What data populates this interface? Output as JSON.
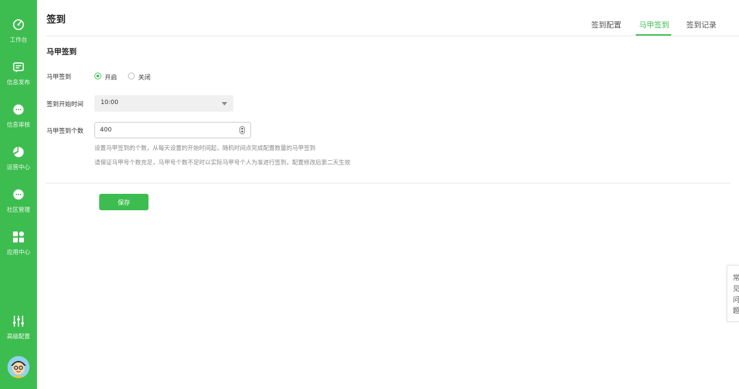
{
  "sidebar": {
    "items": [
      {
        "label": "工作台",
        "icon": "dashboard-icon"
      },
      {
        "label": "信息发布",
        "icon": "publish-icon"
      },
      {
        "label": "信息审核",
        "icon": "review-chat-icon"
      },
      {
        "label": "运营中心",
        "icon": "operations-icon"
      },
      {
        "label": "社区管理",
        "icon": "community-chat-icon"
      },
      {
        "label": "应用中心",
        "icon": "apps-grid-icon"
      }
    ],
    "bottom_item": {
      "label": "高级配置",
      "icon": "sliders-icon"
    }
  },
  "header": {
    "title": "签到",
    "tabs": [
      {
        "label": "签到配置",
        "active": false
      },
      {
        "label": "马甲签到",
        "active": true
      },
      {
        "label": "签到记录",
        "active": false
      }
    ]
  },
  "section": {
    "title": "马甲签到"
  },
  "form": {
    "toggle_label": "马甲签到",
    "toggle_options": [
      {
        "label": "开启",
        "checked": true
      },
      {
        "label": "关闭",
        "checked": false
      }
    ],
    "start_time_label": "签到开始时间",
    "start_time_value": "10:00",
    "count_label": "马甲签到个数",
    "count_value": "400",
    "hint_1": "设置马甲签到的个数，从每天设置的开始时间起，随机时间点完成配置数量的马甲签到",
    "hint_2": "请保证马甲号个数充足，马甲号个数不足时以实际马甲号个人为准进行签到，配置修改后第二天生效"
  },
  "save_label": "保存",
  "faq": {
    "chars": [
      "常",
      "见",
      "问",
      "题"
    ]
  },
  "colors": {
    "accent": "#3dbd4f",
    "sidebar_bg": "#3dbd4f"
  }
}
